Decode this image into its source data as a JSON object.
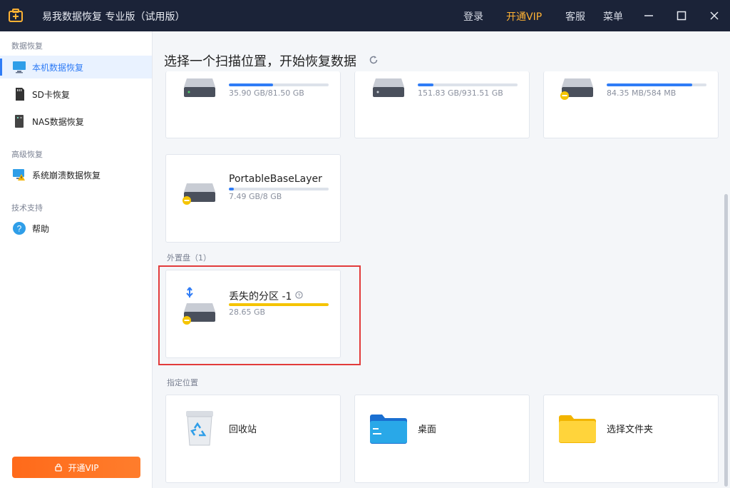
{
  "app": {
    "title": "易我数据恢复 专业版（试用版）"
  },
  "titlebar": {
    "login": "登录",
    "vip": "开通VIP",
    "service": "客服",
    "menu": "菜单"
  },
  "sidebar": {
    "section1": "数据恢复",
    "items": [
      {
        "label": "本机数据恢复"
      },
      {
        "label": "SD卡恢复"
      },
      {
        "label": "NAS数据恢复"
      }
    ],
    "section2": "高级恢复",
    "advanced": [
      {
        "label": "系统崩溃数据恢复"
      }
    ],
    "section3": "技术支持",
    "support": [
      {
        "label": "帮助"
      }
    ],
    "vip_button": "开通VIP"
  },
  "main": {
    "title": "选择一个扫描位置，开始恢复数据",
    "drives": [
      {
        "name": "",
        "size": "35.90 GB/81.50 GB",
        "fill": 0.44
      },
      {
        "name": "",
        "size": "151.83 GB/931.51 GB",
        "fill": 0.16
      },
      {
        "name": "",
        "size": "84.35 MB/584 MB",
        "fill": 0.86
      },
      {
        "name": "PortableBaseLayer",
        "size": "7.49 GB/8 GB",
        "fill": 0.05
      }
    ],
    "external_label": "外置盘（1）",
    "external": {
      "name": "丢失的分区 -1",
      "size": "28.65 GB",
      "fill": 1.0
    },
    "locations_label": "指定位置",
    "locations": [
      {
        "label": "回收站"
      },
      {
        "label": "桌面"
      },
      {
        "label": "选择文件夹"
      }
    ]
  },
  "colors": {
    "accent": "#2f7cf6",
    "vip": "#ff6a1a",
    "highlight": "#e23b3b",
    "external_bar": "#f5c400"
  }
}
